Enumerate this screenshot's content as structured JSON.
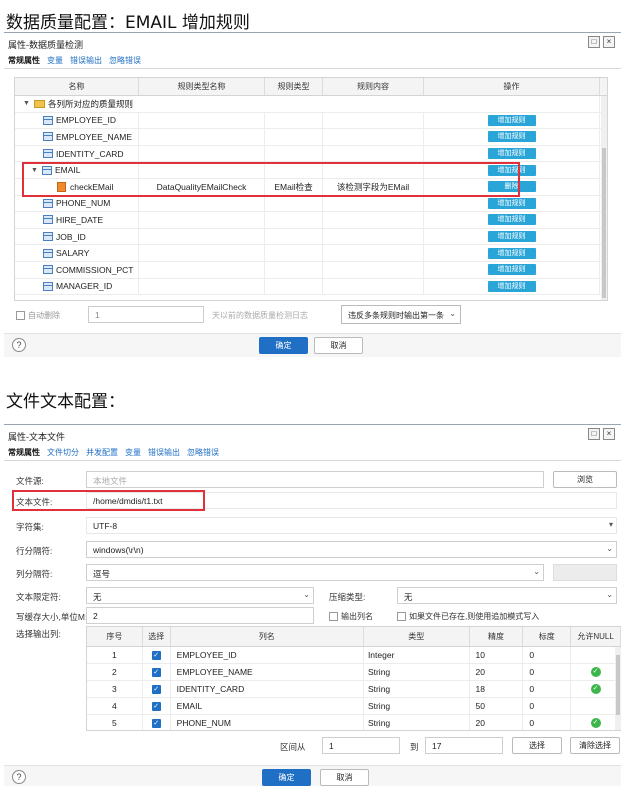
{
  "headings": {
    "first": "数据质量配置：EMAIL 增加规则",
    "second": "文件文本配置："
  },
  "dialog1": {
    "title": "属性-数据质量检测",
    "window_buttons": [
      "□",
      "×"
    ],
    "tabs": [
      "常规属性",
      "变量",
      "错误输出",
      "忽略错误"
    ],
    "columns": [
      "名称",
      "规则类型名称",
      "规则类型",
      "规则内容",
      "操作"
    ],
    "root": "各列所对应的质量规则",
    "rows": [
      {
        "name": "EMPLOYEE_ID",
        "op": "增加规则"
      },
      {
        "name": "EMPLOYEE_NAME",
        "op": "增加规则"
      },
      {
        "name": "IDENTITY_CARD",
        "op": "增加规则"
      },
      {
        "name": "EMAIL",
        "op": "增加规则"
      },
      {
        "name": "checkEMail",
        "type_name": "DataQualityEMailCheck",
        "type": "EMail检查",
        "content": "该检测字段为EMail",
        "op": "删除"
      },
      {
        "name": "PHONE_NUM",
        "op": "增加规则"
      },
      {
        "name": "HIRE_DATE",
        "op": "增加规则"
      },
      {
        "name": "JOB_ID",
        "op": "增加规则"
      },
      {
        "name": "SALARY",
        "op": "增加规则"
      },
      {
        "name": "COMMISSION_PCT",
        "op": "增加规则"
      },
      {
        "name": "MANAGER_ID",
        "op": "增加规则"
      }
    ],
    "auto_delete_label": "自动删除",
    "auto_delete_value": "1",
    "auto_delete_hint": "天以前的数据质量检测日志",
    "violation_select": "违反多条规则时输出第一条",
    "ok": "确定",
    "cancel": "取消",
    "help": "?"
  },
  "dialog2": {
    "title": "属性-文本文件",
    "window_buttons": [
      "□",
      "×"
    ],
    "tabs": [
      "常规属性",
      "文件切分",
      "并发配置",
      "变量",
      "错误输出",
      "忽略错误"
    ],
    "file_source_label": "文件源:",
    "file_source_placeholder": "本地文件",
    "browse": "浏览",
    "text_file_label": "文本文件:",
    "text_file_value": "/home/dmdis/t1.txt",
    "charset_label": "字符集:",
    "charset_value": "UTF-8",
    "row_sep_label": "行分隔符:",
    "row_sep_value": "windows(\\r\\n)",
    "col_sep_label": "列分隔符:",
    "col_sep_value": "逗号",
    "text_qualifier_label": "文本限定符:",
    "text_qualifier_value": "无",
    "compress_label": "压缩类型:",
    "compress_value": "无",
    "cache_label": "写缓存大小,单位M:",
    "cache_value": "2",
    "output_colname": "输出列名",
    "append_mode": "如果文件已存在,则使用追加模式写入",
    "select_cols_label": "选择输出列:",
    "columns": [
      "序号",
      "选择",
      "列名",
      "类型",
      "精度",
      "标度",
      "允许NULL"
    ],
    "rows": [
      {
        "idx": "1",
        "col": "EMPLOYEE_ID",
        "type": "Integer",
        "prec": "10",
        "scale": "0",
        "null": false
      },
      {
        "idx": "2",
        "col": "EMPLOYEE_NAME",
        "type": "String",
        "prec": "20",
        "scale": "0",
        "null": true
      },
      {
        "idx": "3",
        "col": "IDENTITY_CARD",
        "type": "String",
        "prec": "18",
        "scale": "0",
        "null": true
      },
      {
        "idx": "4",
        "col": "EMAIL",
        "type": "String",
        "prec": "50",
        "scale": "0",
        "null": false
      },
      {
        "idx": "5",
        "col": "PHONE_NUM",
        "type": "String",
        "prec": "20",
        "scale": "0",
        "null": true
      }
    ],
    "range_from_label": "区间从",
    "range_from": "1",
    "range_to_label": "到",
    "range_to": "17",
    "select_btn": "选择",
    "clear_btn": "清除选择",
    "ok": "确定",
    "cancel": "取消",
    "help": "?"
  },
  "colors": {
    "accent": "#1f6fc5",
    "add_button": "#29a5d8",
    "highlight": "#e0303a",
    "check_green": "#3cb54a"
  }
}
